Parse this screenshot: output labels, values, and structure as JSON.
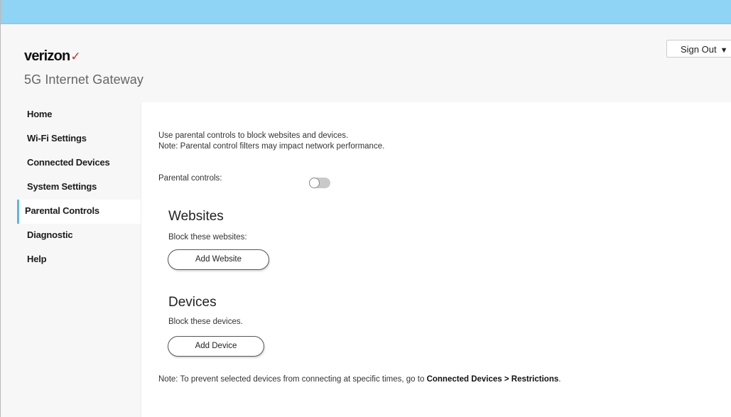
{
  "brand": {
    "logo_text": "verizon",
    "logo_mark": "✓",
    "subtitle": "5G Internet Gateway"
  },
  "header": {
    "signout_label": "Sign Out",
    "signout_caret": "▼"
  },
  "sidebar": {
    "items": [
      {
        "label": "Home"
      },
      {
        "label": "Wi-Fi Settings"
      },
      {
        "label": "Connected Devices"
      },
      {
        "label": "System Settings"
      },
      {
        "label": "Parental Controls",
        "active": true
      },
      {
        "label": "Diagnostic"
      },
      {
        "label": "Help"
      }
    ]
  },
  "main": {
    "intro_line1": "Use parental controls to block websites and devices.",
    "intro_line2": "Note: Parental control filters may impact network performance.",
    "toggle_label": "Parental controls:",
    "toggle_on": false,
    "websites": {
      "title": "Websites",
      "desc": "Block these websites:",
      "button": "Add Website"
    },
    "devices": {
      "title": "Devices",
      "desc": "Block these devices.",
      "button": "Add Device"
    },
    "footnote_prefix": "Note: To prevent selected devices from connecting at specific times, go to ",
    "footnote_link": "Connected Devices > Restrictions",
    "footnote_suffix": "."
  },
  "colors": {
    "top_strip": "#8fd3f5",
    "accent": "#5cb6e6",
    "brand_check": "#d52b1e"
  }
}
